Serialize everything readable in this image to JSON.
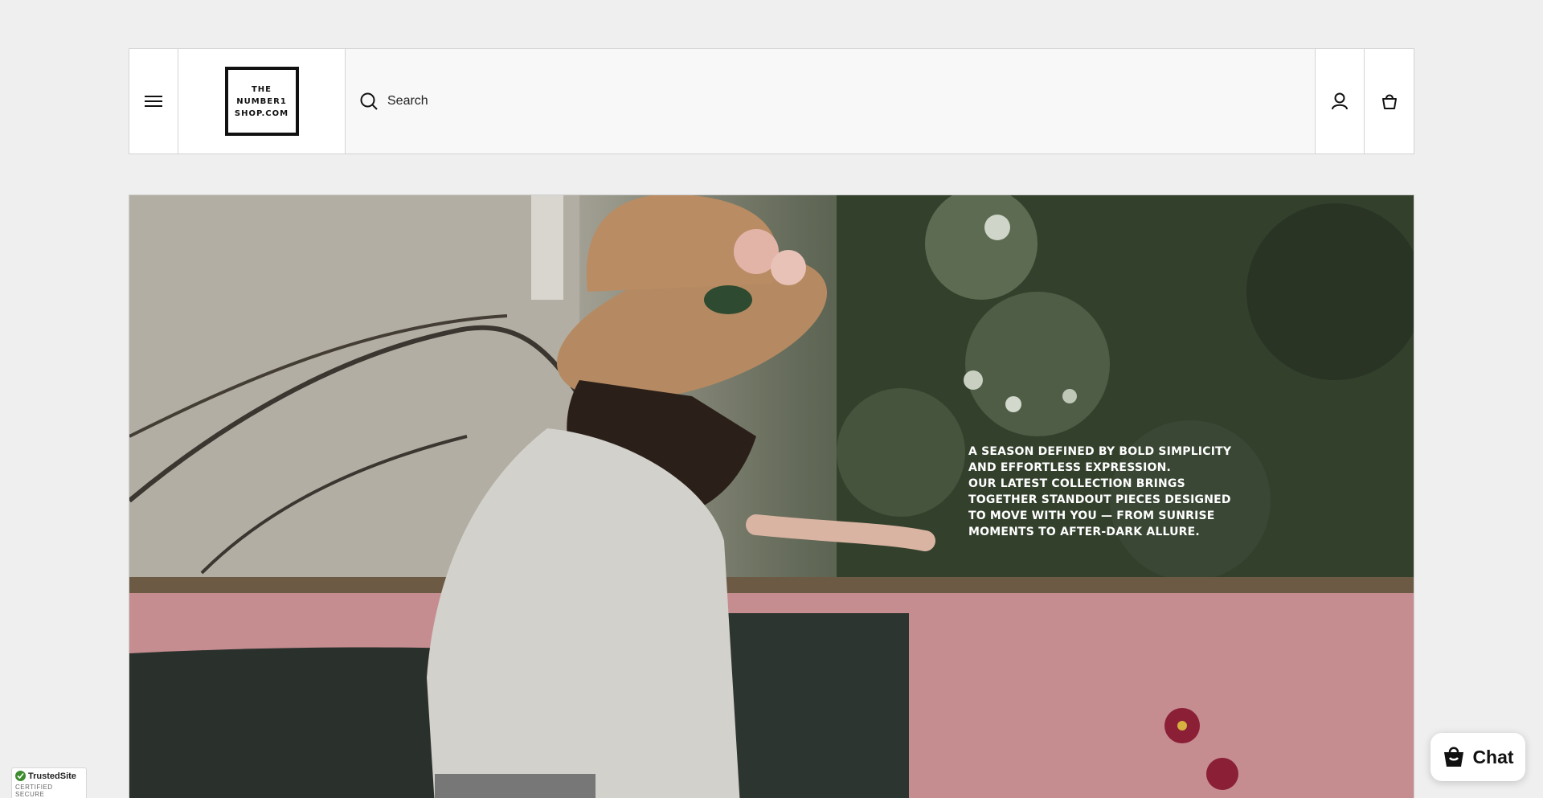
{
  "header": {
    "logo": {
      "line1": "THE",
      "line2": "NUMBER1",
      "line3": "SHOP.COM"
    },
    "search": {
      "label": "Search"
    },
    "icons": {
      "menu": "menu-icon",
      "search": "search-icon",
      "account": "account-icon",
      "cart": "cart-icon"
    }
  },
  "hero": {
    "line1": "A SEASON DEFINED BY BOLD SIMPLICITY AND EFFORTLESS EXPRESSION.",
    "line2": "OUR LATEST COLLECTION BRINGS TOGETHER STANDOUT PIECES DESIGNED TO MOVE WITH YOU — FROM SUNRISE MOMENTS TO AFTER-DARK ALLURE."
  },
  "trust_badge": {
    "name": "TrustedSite",
    "tagline": "CERTIFIED SECURE"
  },
  "chat": {
    "label": "Chat"
  },
  "colors": {
    "page_background": "#efefef",
    "header_border": "#d4d4d4",
    "trust_green": "#3d8c2e"
  }
}
